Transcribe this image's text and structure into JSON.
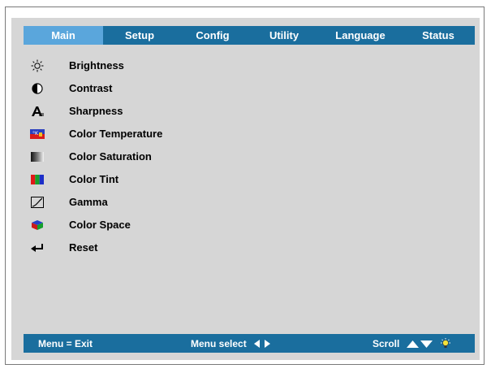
{
  "tabs": [
    {
      "label": "Main",
      "active": true
    },
    {
      "label": "Setup",
      "active": false
    },
    {
      "label": "Config",
      "active": false
    },
    {
      "label": "Utility",
      "active": false
    },
    {
      "label": "Language",
      "active": false
    },
    {
      "label": "Status",
      "active": false
    }
  ],
  "menu": {
    "items": [
      {
        "label": "Brightness",
        "icon": "sun-icon"
      },
      {
        "label": "Contrast",
        "icon": "half-circle-icon"
      },
      {
        "label": "Sharpness",
        "icon": "sharpness-a-icon"
      },
      {
        "label": "Color Temperature",
        "icon": "color-temperature-icon"
      },
      {
        "label": "Color Saturation",
        "icon": "saturation-gradient-icon"
      },
      {
        "label": "Color Tint",
        "icon": "tint-rgb-icon"
      },
      {
        "label": "Gamma",
        "icon": "gamma-curve-icon"
      },
      {
        "label": "Color Space",
        "icon": "color-cube-icon"
      },
      {
        "label": "Reset",
        "icon": "return-arrow-icon"
      }
    ]
  },
  "footer": {
    "exit_label": "Menu = Exit",
    "select_label": "Menu select",
    "scroll_label": "Scroll"
  },
  "colors": {
    "bar": "#1a6e9e",
    "tab_active": "#5aa6dc",
    "panel": "#d6d6d6"
  }
}
